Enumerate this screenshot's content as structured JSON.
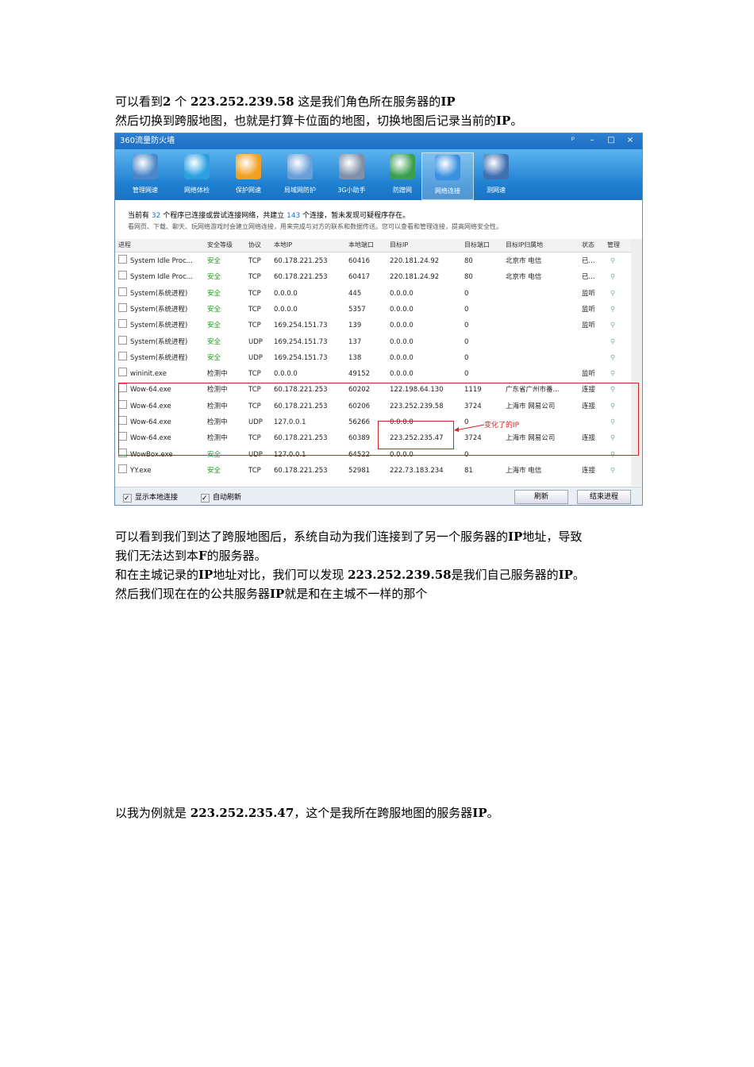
{
  "doc": {
    "p1_a": "可以看到",
    "p1_b": "2",
    "p1_c": "个",
    "p1_d": "223.252.239.58",
    "p1_e": "这是我们角色所在服务器的",
    "p1_f": "IP",
    "p2_a": "然后切换到跨服地图，也就是打算卡位面的地图，切换地图后记录当前的",
    "p2_b": "IP",
    "p2_c": "。",
    "p3_a": "可以看到我们到达了跨服地图后，系统自动为我们连接到了另一个服务器的",
    "p3_b": "IP",
    "p3_c": "地址，导致",
    "p4": "我们无法达到本",
    "p4_b": "F",
    "p4_c": "的服务器。",
    "p5_a": "和在主城记录的",
    "p5_b": "IP",
    "p5_c": "地址对比，我们可以发现",
    "p5_d": "223.252.239.58",
    "p5_e": "是我们自己服务器的",
    "p5_f": "IP",
    "p5_g": "。",
    "p6_a": "然后我们现在在的公共服务器",
    "p6_b": "IP",
    "p6_c": "就是和在主城不一样的那个",
    "p7_a": "以我为例就是",
    "p7_b": "223.252.235.47",
    "p7_c": "，这个是我所在跨服地图的服务器",
    "p7_d": "IP",
    "p7_e": "。"
  },
  "window": {
    "title": "360流量防火墙",
    "controls": [
      "ᵖ",
      "–",
      "□",
      "×"
    ],
    "tools": [
      {
        "label": "管理网速",
        "icon": "speed-icon",
        "color": "#4a86c8"
      },
      {
        "label": "网络体检",
        "icon": "checkup-icon",
        "color": "#2aa0e0"
      },
      {
        "label": "保护网速",
        "icon": "lightning-icon",
        "color": "#f0a020"
      },
      {
        "label": "局域网防护",
        "icon": "firewall-wall-icon",
        "color": "#6aa0d8"
      },
      {
        "label": "3G小助手",
        "icon": "3g-icon",
        "color": "#8090a8"
      },
      {
        "label": "防蹭网",
        "icon": "shield-globe-icon",
        "color": "#3aa050"
      },
      {
        "label": "网络连接",
        "icon": "network-monitor-icon",
        "color": "#3a90e0"
      },
      {
        "label": "测网速",
        "icon": "speedometer-icon",
        "color": "#4070b0"
      }
    ],
    "info_line1_a": "当前有",
    "info_line1_n1": "32",
    "info_line1_b": "个程序已连接或尝试连接网络，共建立",
    "info_line1_n2": "143",
    "info_line1_c": "个连接，暂未发现可疑程序存在。",
    "info_line2": "看网页、下载、聊天、玩网络游戏时会建立网络连接，用来完成与对方的联系和数据传送。您可以查看和管理连接，提高网络安全性。",
    "headers": [
      "进程",
      "安全等级",
      "协议",
      "本地IP",
      "本地端口",
      "目标IP",
      "目标端口",
      "目标IP归属地",
      "状态",
      "管理"
    ],
    "rows": [
      {
        "proc": "System Idle Proc...",
        "level": "安全",
        "proto": "TCP",
        "lip": "60.178.221.253",
        "lport": "60416",
        "tip": "220.181.24.92",
        "tport": "80",
        "loc": "北京市 电信",
        "state": "已..."
      },
      {
        "proc": "System Idle Proc...",
        "level": "安全",
        "proto": "TCP",
        "lip": "60.178.221.253",
        "lport": "60417",
        "tip": "220.181.24.92",
        "tport": "80",
        "loc": "北京市 电信",
        "state": "已..."
      },
      {
        "proc": "System(系统进程)",
        "level": "安全",
        "proto": "TCP",
        "lip": "0.0.0.0",
        "lport": "445",
        "tip": "0.0.0.0",
        "tport": "0",
        "loc": "",
        "state": "监听"
      },
      {
        "proc": "System(系统进程)",
        "level": "安全",
        "proto": "TCP",
        "lip": "0.0.0.0",
        "lport": "5357",
        "tip": "0.0.0.0",
        "tport": "0",
        "loc": "",
        "state": "监听"
      },
      {
        "proc": "System(系统进程)",
        "level": "安全",
        "proto": "TCP",
        "lip": "169.254.151.73",
        "lport": "139",
        "tip": "0.0.0.0",
        "tport": "0",
        "loc": "",
        "state": "监听"
      },
      {
        "proc": "System(系统进程)",
        "level": "安全",
        "proto": "UDP",
        "lip": "169.254.151.73",
        "lport": "137",
        "tip": "0.0.0.0",
        "tport": "0",
        "loc": "",
        "state": ""
      },
      {
        "proc": "System(系统进程)",
        "level": "安全",
        "proto": "UDP",
        "lip": "169.254.151.73",
        "lport": "138",
        "tip": "0.0.0.0",
        "tport": "0",
        "loc": "",
        "state": ""
      },
      {
        "proc": "wininit.exe",
        "level": "检测中",
        "proto": "TCP",
        "lip": "0.0.0.0",
        "lport": "49152",
        "tip": "0.0.0.0",
        "tport": "0",
        "loc": "",
        "state": "监听"
      },
      {
        "proc": "Wow-64.exe",
        "level": "检测中",
        "proto": "TCP",
        "lip": "60.178.221.253",
        "lport": "60202",
        "tip": "122.198.64.130",
        "tport": "1119",
        "loc": "广东省广州市番...",
        "state": "连接"
      },
      {
        "proc": "Wow-64.exe",
        "level": "检测中",
        "proto": "TCP",
        "lip": "60.178.221.253",
        "lport": "60206",
        "tip": "223.252.239.58",
        "tport": "3724",
        "loc": "上海市 网易公司",
        "state": "连接"
      },
      {
        "proc": "Wow-64.exe",
        "level": "检测中",
        "proto": "UDP",
        "lip": "127.0.0.1",
        "lport": "56266",
        "tip": "0.0.0.0",
        "tport": "0",
        "loc": "",
        "state": ""
      },
      {
        "proc": "Wow-64.exe",
        "level": "检测中",
        "proto": "TCP",
        "lip": "60.178.221.253",
        "lport": "60389",
        "tip": "223.252.235.47",
        "tport": "3724",
        "loc": "上海市 网易公司",
        "state": "连接"
      },
      {
        "proc": "WowBox.exe",
        "level": "安全",
        "proto": "UDP",
        "lip": "127.0.0.1",
        "lport": "64522",
        "tip": "0.0.0.0",
        "tport": "0",
        "loc": "",
        "state": ""
      },
      {
        "proc": "YY.exe",
        "level": "安全",
        "proto": "TCP",
        "lip": "60.178.221.253",
        "lport": "52981",
        "tip": "222.73.183.234",
        "tport": "81",
        "loc": "上海市 电信",
        "state": "连接"
      }
    ],
    "annotation": "变化了的IP",
    "footer_show_local": "显示本地连接",
    "footer_auto_refresh": "自动刷新",
    "btn_refresh": "刷新",
    "btn_end": "结束进程"
  }
}
